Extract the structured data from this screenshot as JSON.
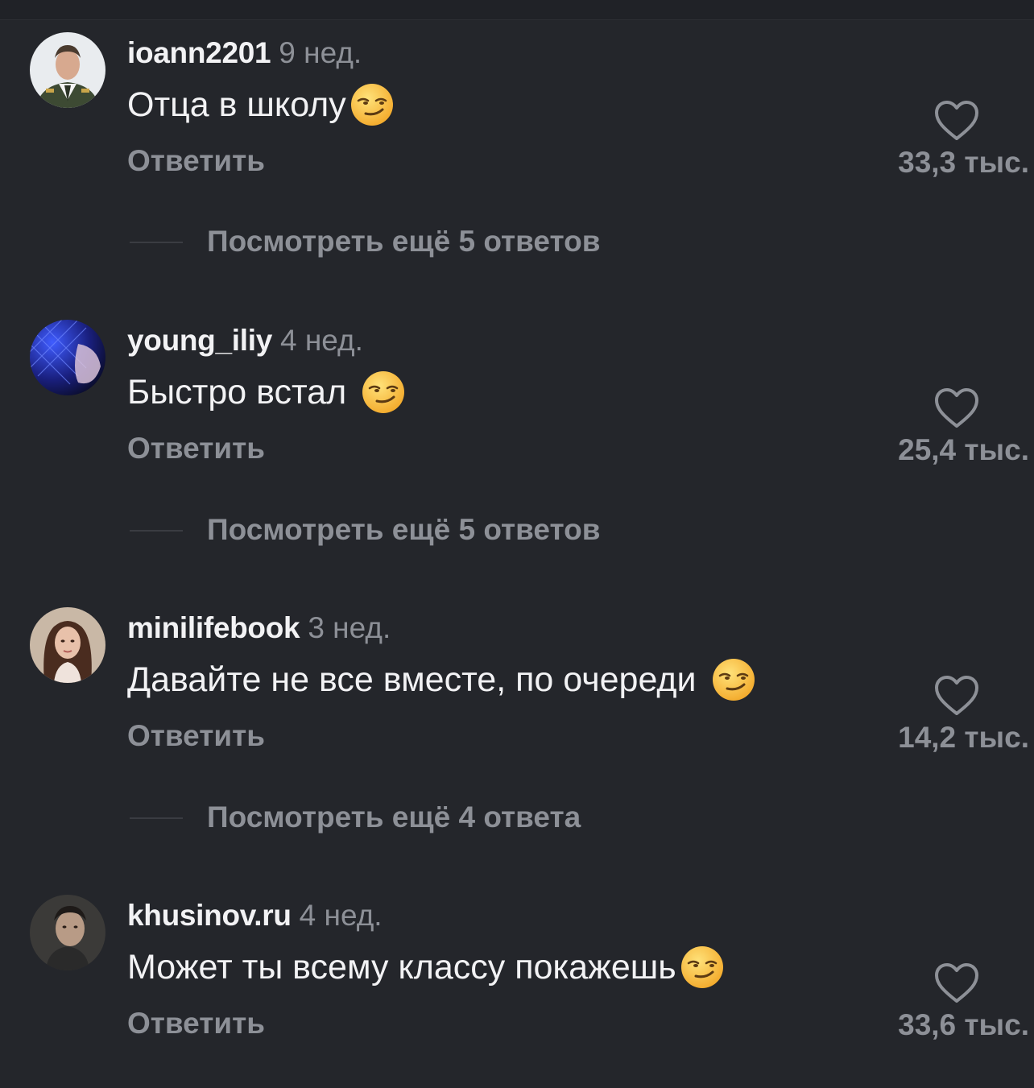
{
  "comments": [
    {
      "username": "ioann2201",
      "time": "9 нед.",
      "text": "Отца в школу",
      "reply": "Ответить",
      "likes": "33,3 тыс.",
      "emoji": "smirk-emoji"
    },
    {
      "username": "young_iliy",
      "time": "4 нед.",
      "text": "Быстро встал",
      "reply": "Ответить",
      "likes": "25,4 тыс.",
      "emoji": "smirk-emoji"
    },
    {
      "username": "minilifebook",
      "time": "3 нед.",
      "text": "Давайте не все вместе, по очереди",
      "reply": "Ответить",
      "likes": "14,2 тыс.",
      "emoji": "smirk-emoji"
    },
    {
      "username": "khusinov.ru",
      "time": "4 нед.",
      "text": "Может ты всему классу покажешь",
      "reply": "Ответить",
      "likes": "33,6 тыс.",
      "emoji": "smirk-emoji"
    }
  ],
  "more_replies": [
    "Посмотреть ещё 5 ответов",
    "Посмотреть ещё 5 ответов",
    "Посмотреть ещё 4 ответа"
  ],
  "colors": {
    "background": "#24262b",
    "primary_text": "#f2f2f4",
    "secondary_text": "#8d9097"
  },
  "icons": {
    "like": "heart-outline-icon"
  }
}
